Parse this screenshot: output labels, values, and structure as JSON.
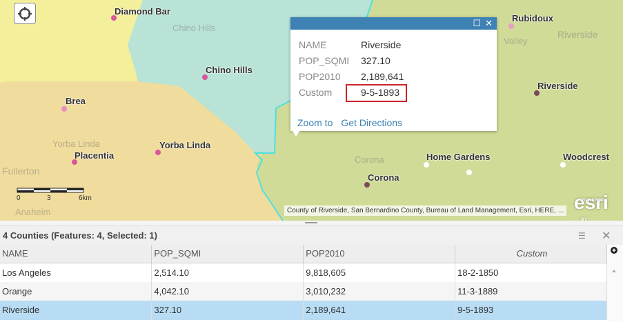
{
  "map": {
    "cities": [
      {
        "name": "Diamond Bar"
      },
      {
        "name": "Chino Hills"
      },
      {
        "name": "Brea"
      },
      {
        "name": "Yorba Linda"
      },
      {
        "name": "Placentia"
      },
      {
        "name": "Rubidoux"
      },
      {
        "name": "Riverside"
      },
      {
        "name": "Corona"
      },
      {
        "name": "Home Gardens"
      },
      {
        "name": "Woodcrest"
      }
    ],
    "basemap_labels": [
      "Chino Hills",
      "Fullerton",
      "Yorba Linda",
      "Anaheim",
      "Corona",
      "Riverside",
      "Valley"
    ],
    "scale": {
      "t0": "0",
      "t1": "3",
      "t2": "6km"
    },
    "attribution": "County of Riverside, San Bernardino County, Bureau of Land Management, Esri, HERE, ...",
    "esri_logo": "esri",
    "esri_powered": "POWERED BY",
    "colors": {
      "la": "#f4ef9a",
      "orange": "#f0dc9c",
      "sanbernardino": "#b8e3d6",
      "riverside": "#cfdb97",
      "border": "#4fe0e0"
    }
  },
  "popup": {
    "fields": [
      {
        "label": "NAME",
        "value": "Riverside"
      },
      {
        "label": "POP_SQMI",
        "value": "327.10"
      },
      {
        "label": "POP2010",
        "value": "2,189,641"
      },
      {
        "label": "Custom",
        "value": "9-5-1893"
      }
    ],
    "zoom_to": "Zoom to",
    "directions": "Get Directions",
    "maximize": "☐",
    "close": "✕"
  },
  "table": {
    "title": "4 Counties (Features: 4, Selected: 1)",
    "menu": "☰",
    "close": "✕",
    "columns": [
      "NAME",
      "POP_SQMI",
      "POP2010",
      "Custom"
    ],
    "rows": [
      [
        "Los Angeles",
        "2,514.10",
        "9,818,605",
        "18-2-1850"
      ],
      [
        "Orange",
        "4,042.10",
        "3,010,232",
        "11-3-1889"
      ],
      [
        "Riverside",
        "327.10",
        "2,189,641",
        "9-5-1893"
      ]
    ],
    "selected_row": 2
  }
}
